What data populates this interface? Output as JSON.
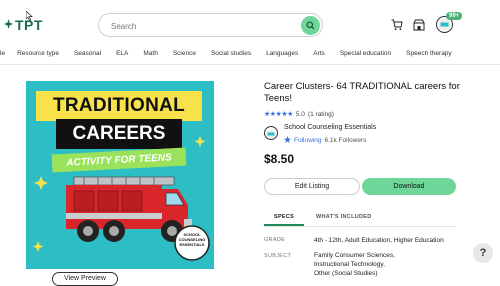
{
  "header": {
    "logo_text": "TPT",
    "search_placeholder": "Search",
    "cart_count": "99+"
  },
  "nav": {
    "items": [
      "le",
      "Resource type",
      "Seasonal",
      "ELA",
      "Math",
      "Science",
      "Social studies",
      "Languages",
      "Arts",
      "Special education",
      "Speech therapy"
    ]
  },
  "product": {
    "image": {
      "line1": "TRADITIONAL",
      "line2": "CAREERS",
      "line3": "ACTIVITY FOR TEENS",
      "seal_text": "SCHOOL COUNSELING ESSENTIALS"
    },
    "view_preview": "View Preview",
    "title": "Career Clusters- 64 TRADITIONAL careers for Teens!",
    "rating_value": "5.0",
    "rating_count": "(1 rating)",
    "seller": "School Counseling Essentials",
    "following_label": "Following",
    "followers": "6.1k Followers",
    "price": "$8.50",
    "edit_label": "Edit Listing",
    "download_label": "Download",
    "tabs": [
      "SPECS",
      "WHAT'S INCLUDED"
    ],
    "specs": {
      "grade_label": "GRADE",
      "grade_value": "4th - 12th, Adult Education, Higher Education",
      "subject_label": "SUBJECT",
      "subject_values": [
        "Family Consumer Sciences,",
        "Instructional Technology,",
        "Other (Social Studies)"
      ]
    }
  },
  "help_label": "?",
  "colors": {
    "brand": "#1d6b4e",
    "accent_green": "#6fd69a",
    "star_blue": "#3b6fd8",
    "image_bg": "#2cbec4"
  }
}
